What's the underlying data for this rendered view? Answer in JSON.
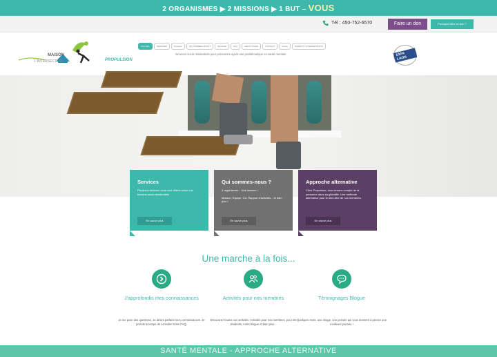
{
  "topbar": {
    "text": "2 ORGANISMES ▶ 2 MISSIONS ▶ 1 BUT – ",
    "emphasis": "VOUS"
  },
  "contact": {
    "phone": "Tél : 450-752-6570",
    "donate_label": "Faire un don",
    "secondary_label": "Pourquoi faire un don ?"
  },
  "logo": {
    "maison": "MAISON",
    "subtitle": "L'INTERSECTION",
    "propulsion": "PROPULSION"
  },
  "nav": {
    "items": [
      "ACCUEIL",
      "SERVICES",
      "Pression",
      "QUI SOMMES-NOUS ?",
      "BLOGUE",
      "FAQ",
      "LIENS UTILES",
      "CONTACT",
      "Forum",
      "PARENTS / INTERVENTIONS"
    ]
  },
  "tagline": "Services socio-résidentiels pour personnes ayant une problématique en santé mentale",
  "badge": {
    "text": "100% LAON"
  },
  "cards": [
    {
      "title": "Services",
      "body": "Plusieurs services vous sont offerts selon vos besoins socio-résidentiels",
      "button": "En savoir plus"
    },
    {
      "title": "Qui sommes-nous ?",
      "subtitle": "2 organismes... Une mission !",
      "body": "Mission, Equipe, CA, Rapport d'activités... et bien plus !",
      "button": "En savoir plus"
    },
    {
      "title": "Approche alternative",
      "body": "Chez Propulsion, nous tenons compte de la personne dans sa globalité. Une méthode alternative pour le bien-être de nos membres.",
      "button": "En savoir plus"
    }
  ],
  "section": {
    "title": "Une marche à la fois..."
  },
  "features": [
    {
      "icon": "arrow-right-icon",
      "title": "J'approfondis mes connaissances",
      "desc": "Je me pose des questions. Je désire parfaire mes connaissances. Je prends le temps de consulter notre FAQ."
    },
    {
      "icon": "people-icon",
      "title": "Activités pour nos membres",
      "desc": "Découvrez toutes nos activités. Activités pour nos membres, pour les résidents, notre blogue et bien plus..."
    },
    {
      "icon": "chat-icon",
      "title": "Témoignages Blogue",
      "desc": "Quelques mots, une image, une pensée qui vous donnent à penser une meilleure journée !"
    }
  ],
  "footer": {
    "text": "SANTÉ MENTALE - APPROCHE ALTERNATIVE"
  },
  "colors": {
    "teal": "#3fb8ac",
    "green": "#2aab86",
    "purple": "#7b4e8a",
    "gray": "#707170",
    "footer": "#5cc6a8"
  }
}
